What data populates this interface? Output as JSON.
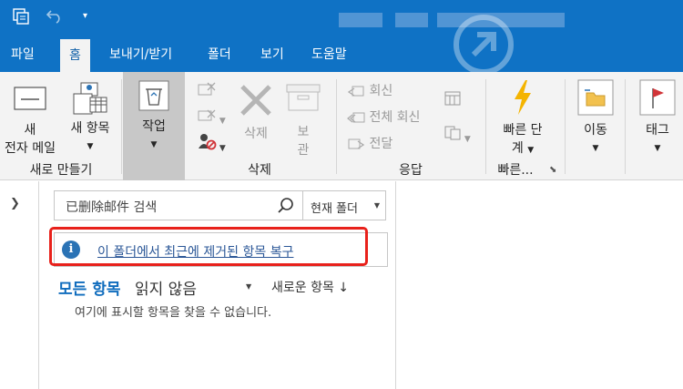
{
  "tabs": [
    "파일",
    "홈",
    "보내기/받기",
    "폴더",
    "보기",
    "도움말"
  ],
  "ribbon": {
    "new_group": {
      "new_email": [
        "새",
        "전자 메일"
      ],
      "new_items": "새 항목",
      "label": "새로 만들기"
    },
    "delete_group": {
      "tasks": "작업",
      "delete": "삭제",
      "archive": [
        "보",
        "관"
      ],
      "label": "삭제"
    },
    "respond_group": {
      "reply": "회신",
      "reply_all": "전체 회신",
      "forward": "전달",
      "label": "응답"
    },
    "quick_group": {
      "quick_steps": [
        "빠른 단",
        "계"
      ],
      "label": "빠른..."
    },
    "move_group": {
      "move": "이동"
    },
    "tags_group": {
      "tags": "태그"
    }
  },
  "search": {
    "text": "已删除邮件 검색",
    "scope": "현재 폴더"
  },
  "info": {
    "recover_link": "이 폴더에서 최근에 제거된 항목 복구"
  },
  "filters": {
    "all": "모든 항목",
    "unread": "읽지 않음",
    "sort": "새로운 항목 ↓"
  },
  "empty_message": "여기에 표시할 항목을 찾을 수 없습니다.",
  "colors": {
    "brand": "#0f72c5",
    "highlight": "#e8211b",
    "link": "#2b5797"
  }
}
